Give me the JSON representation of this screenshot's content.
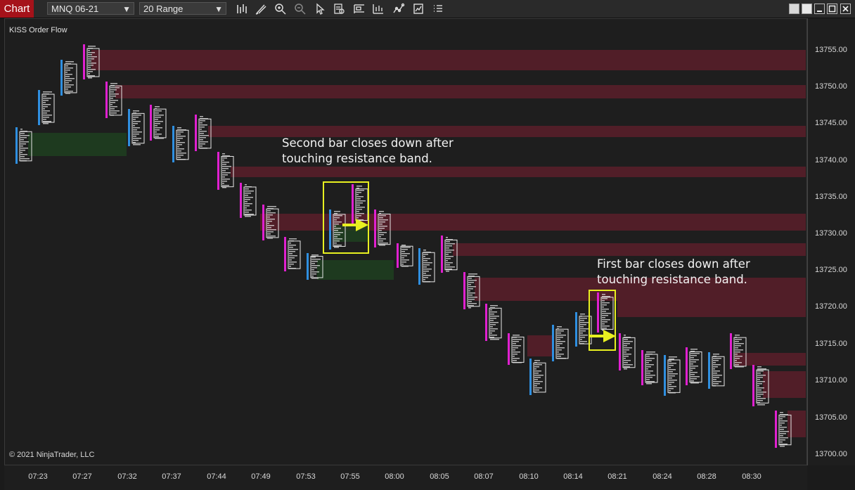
{
  "toolbar": {
    "tab_label": "Chart",
    "instrument": "MNQ 06-21",
    "bar_type": "20 Range",
    "tools": [
      "bar-type-icon",
      "pencil-icon",
      "zoom-in-icon",
      "zoom-out-icon",
      "pointer-icon",
      "data-box-icon",
      "template-icon",
      "indicators-icon",
      "strategies-icon",
      "properties-icon",
      "list-icon"
    ]
  },
  "chart": {
    "indicator_name": "KISS Order Flow",
    "copyright": "© 2021 NinjaTrader, LLC",
    "annotation_1": [
      "Second bar closes down after",
      "touching resistance band."
    ],
    "annotation_2": [
      "First bar closes down after",
      "touching resistance band."
    ],
    "colors": {
      "up": "#2f8fe0",
      "down": "#e020d0",
      "resistance_band": "#5a1e2a",
      "support_band": "#1e4020",
      "highlight": "#e8f020"
    }
  },
  "price_axis": [
    "13755.00",
    "13750.00",
    "13745.00",
    "13740.00",
    "13735.00",
    "13730.00",
    "13725.00",
    "13720.00",
    "13715.00",
    "13710.00",
    "13705.00",
    "13700.00"
  ],
  "time_axis": [
    "07:23",
    "07:27",
    "07:32",
    "07:37",
    "07:44",
    "07:49",
    "07:53",
    "07:55",
    "08:00",
    "08:05",
    "08:07",
    "08:10",
    "08:14",
    "08:21",
    "08:24",
    "08:28",
    "08:30"
  ]
}
